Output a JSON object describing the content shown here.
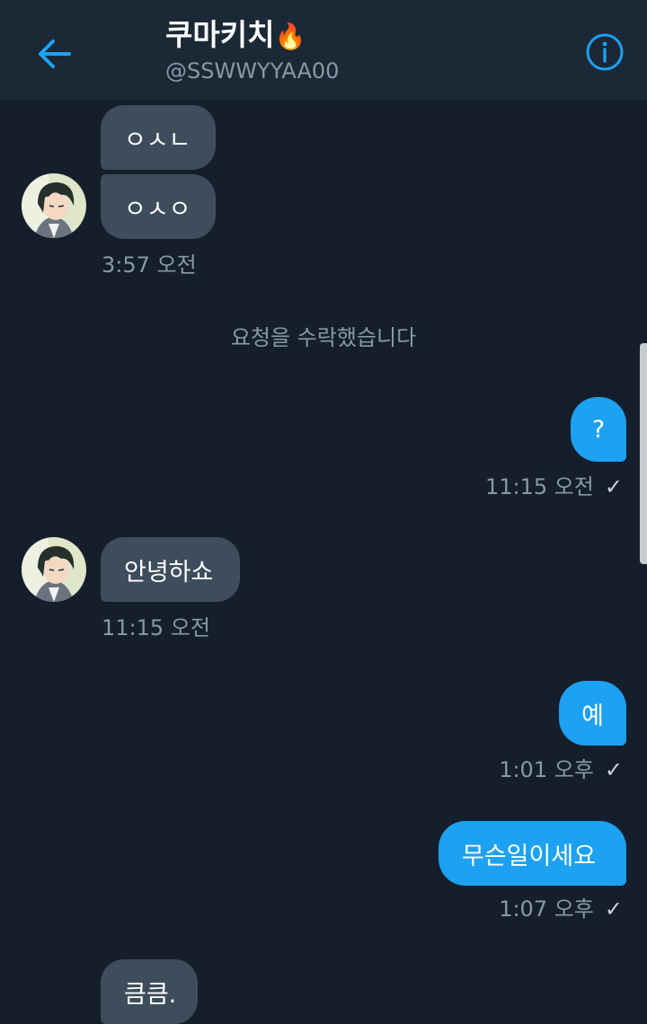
{
  "header": {
    "title": "쿠마키치",
    "title_emoji": "🔥",
    "handle": "@SSWWYYAA00",
    "back_icon": "arrow-left-icon",
    "info_icon": "info-icon",
    "accent": "#1da1f2"
  },
  "conversation": {
    "msg1": "ㅇㅅㄴ",
    "msg2": "ㅇㅅㅇ",
    "ts1": "3:57 오전",
    "system_note": "요청을 수락했습니다",
    "msg3": "?",
    "ts2": "11:15 오전",
    "msg4": "안녕하쇼",
    "ts3": "11:15 오전",
    "msg5": "예",
    "ts4": "1:01 오후",
    "msg6": "무슨일이세요",
    "ts5": "1:07 오후",
    "msg7": "큼큼.",
    "check": "✓"
  },
  "colors": {
    "background": "#151f2b",
    "header_bg": "#1b2836",
    "incoming_bubble": "#3d4d5c",
    "outgoing_bubble": "#1da1f2",
    "secondary_text": "#8899a6"
  }
}
